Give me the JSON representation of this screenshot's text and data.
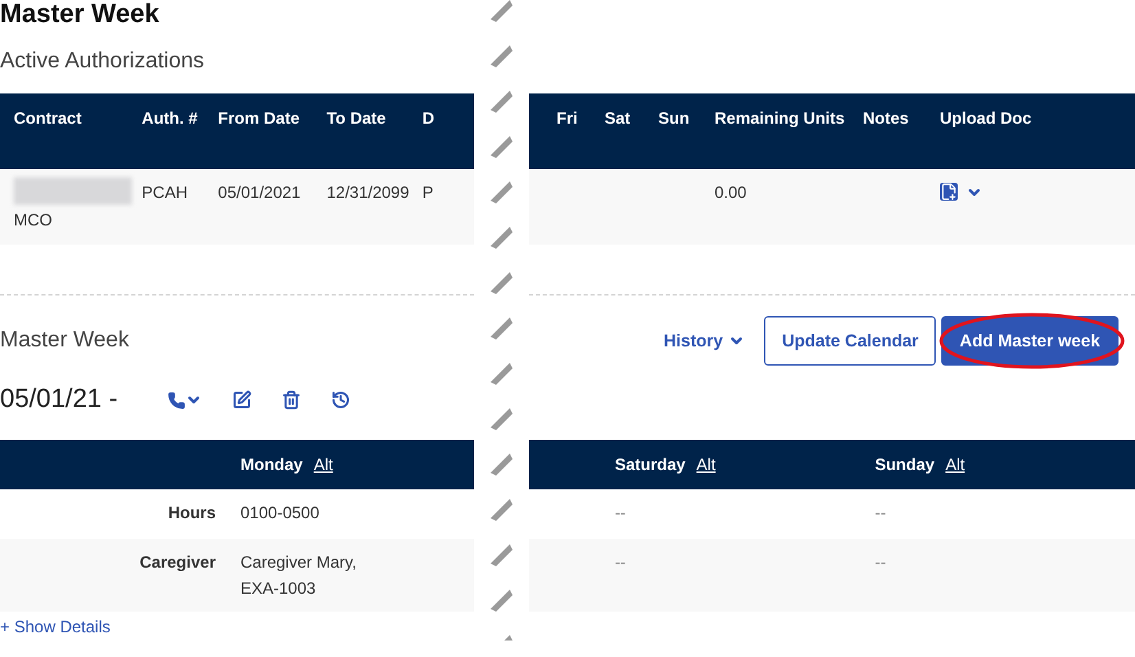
{
  "page": {
    "title": "Master Week"
  },
  "authorizations": {
    "heading": "Active Authorizations",
    "columns_left": [
      "Contract",
      "Auth. #",
      "From Date",
      "To Date",
      "D"
    ],
    "columns_right": [
      "Fri",
      "Sat",
      "Sun",
      "Remaining Units",
      "Notes",
      "Upload Doc"
    ],
    "rows": [
      {
        "contract": "MCO",
        "auth": "PCAH",
        "from_date": "05/01/2021",
        "to_date": "12/31/2099",
        "column_5": "P",
        "remaining_units": "0.00"
      }
    ]
  },
  "master_week": {
    "heading": "Master Week",
    "history_label": "History",
    "buttons": [
      {
        "label": "Update Calendar",
        "kind": "outline",
        "highlighted": false
      },
      {
        "label": "Add Master week",
        "kind": "primary",
        "highlighted": true
      }
    ],
    "date_range": "05/01/21 -",
    "days_left": [
      {
        "day": "Monday",
        "alt": "Alt"
      }
    ],
    "days_right": [
      {
        "day": "Saturday",
        "alt": "Alt"
      },
      {
        "day": "Sunday",
        "alt": "Alt"
      }
    ],
    "rows": [
      {
        "label": "Hours",
        "left": [
          "0100-0500"
        ],
        "right": [
          "--",
          "--"
        ]
      },
      {
        "label": "Caregiver",
        "left": [
          "Caregiver Mary, EXA-1003"
        ],
        "right": [
          "--",
          "--"
        ]
      }
    ],
    "show_details": "+ Show Details"
  }
}
